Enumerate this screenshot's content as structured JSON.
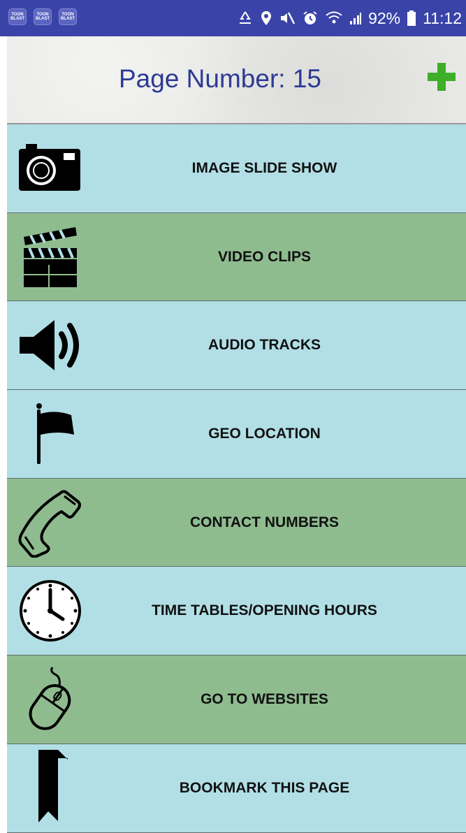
{
  "status_bar": {
    "app_badges": [
      "TOON BLAST",
      "TOON BLAST",
      "TOON BLAST"
    ],
    "battery_percent": "92%",
    "time": "11:12"
  },
  "header": {
    "title": "Page Number: 15",
    "add_icon": "plus-icon",
    "accent_color": "#3fae29"
  },
  "menu": {
    "items": [
      {
        "label": "IMAGE SLIDE SHOW",
        "icon": "camera-icon",
        "color": "#b2dfe6"
      },
      {
        "label": "VIDEO CLIPS",
        "icon": "clapperboard-icon",
        "color": "#8fbc8f"
      },
      {
        "label": "AUDIO TRACKS",
        "icon": "speaker-icon",
        "color": "#b2dfe6"
      },
      {
        "label": "GEO LOCATION",
        "icon": "flag-icon",
        "color": "#b2dfe6"
      },
      {
        "label": "CONTACT NUMBERS",
        "icon": "phone-icon",
        "color": "#8fbc8f"
      },
      {
        "label": "TIME TABLES/OPENING HOURS",
        "icon": "clock-icon",
        "color": "#b2dfe6"
      },
      {
        "label": "GO TO WEBSITES",
        "icon": "mouse-icon",
        "color": "#8fbc8f"
      },
      {
        "label": "BOOKMARK THIS PAGE",
        "icon": "bookmark-icon",
        "color": "#b2dfe6"
      }
    ]
  }
}
